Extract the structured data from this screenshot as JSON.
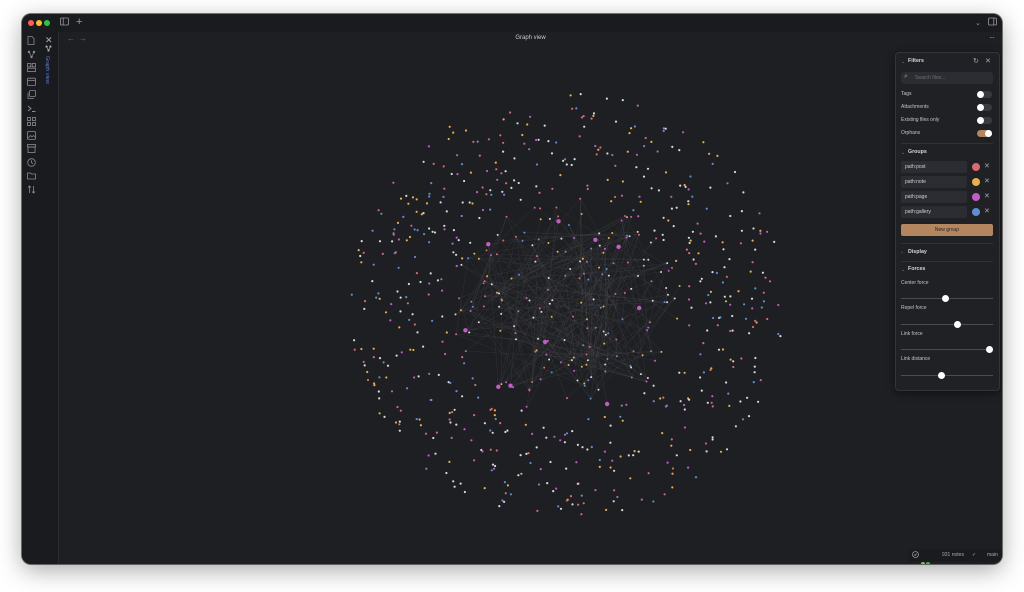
{
  "header": {
    "view_title": "Graph view",
    "tab_label": "Graph view"
  },
  "graph": {
    "background": "#1e1f22",
    "node_color_default": "#d9d9dc",
    "edge_color": "#4e4f55"
  },
  "filters": {
    "title": "Filters",
    "search_placeholder": "Search files...",
    "tags_label": "Tags",
    "tags_on": false,
    "attachments_label": "Attachments",
    "attachments_on": false,
    "existing_files_label": "Existing files only",
    "existing_files_on": false,
    "orphans_label": "Orphans",
    "orphans_on": true
  },
  "groups": {
    "title": "Groups",
    "items": [
      {
        "query": "path:post",
        "color": "#d96a6f"
      },
      {
        "query": "path:note",
        "color": "#e6b04e"
      },
      {
        "query": "path:page",
        "color": "#c25dc7"
      },
      {
        "query": "path:gallery",
        "color": "#5f8fd0"
      }
    ],
    "new_group_label": "New group"
  },
  "display": {
    "title": "Display"
  },
  "forces": {
    "title": "Forces",
    "center_label": "Center force",
    "center_value": 0.5,
    "repel_label": "Repel force",
    "repel_value": 0.64,
    "link_force_label": "Link force",
    "link_force_value": 1.0,
    "link_distance_label": "Link distance",
    "link_distance_value": 0.46
  },
  "status": {
    "notes": "931 notes",
    "branch": "main",
    "sync_dot_colors": [
      "#8bc34a",
      "#4caf50"
    ]
  }
}
